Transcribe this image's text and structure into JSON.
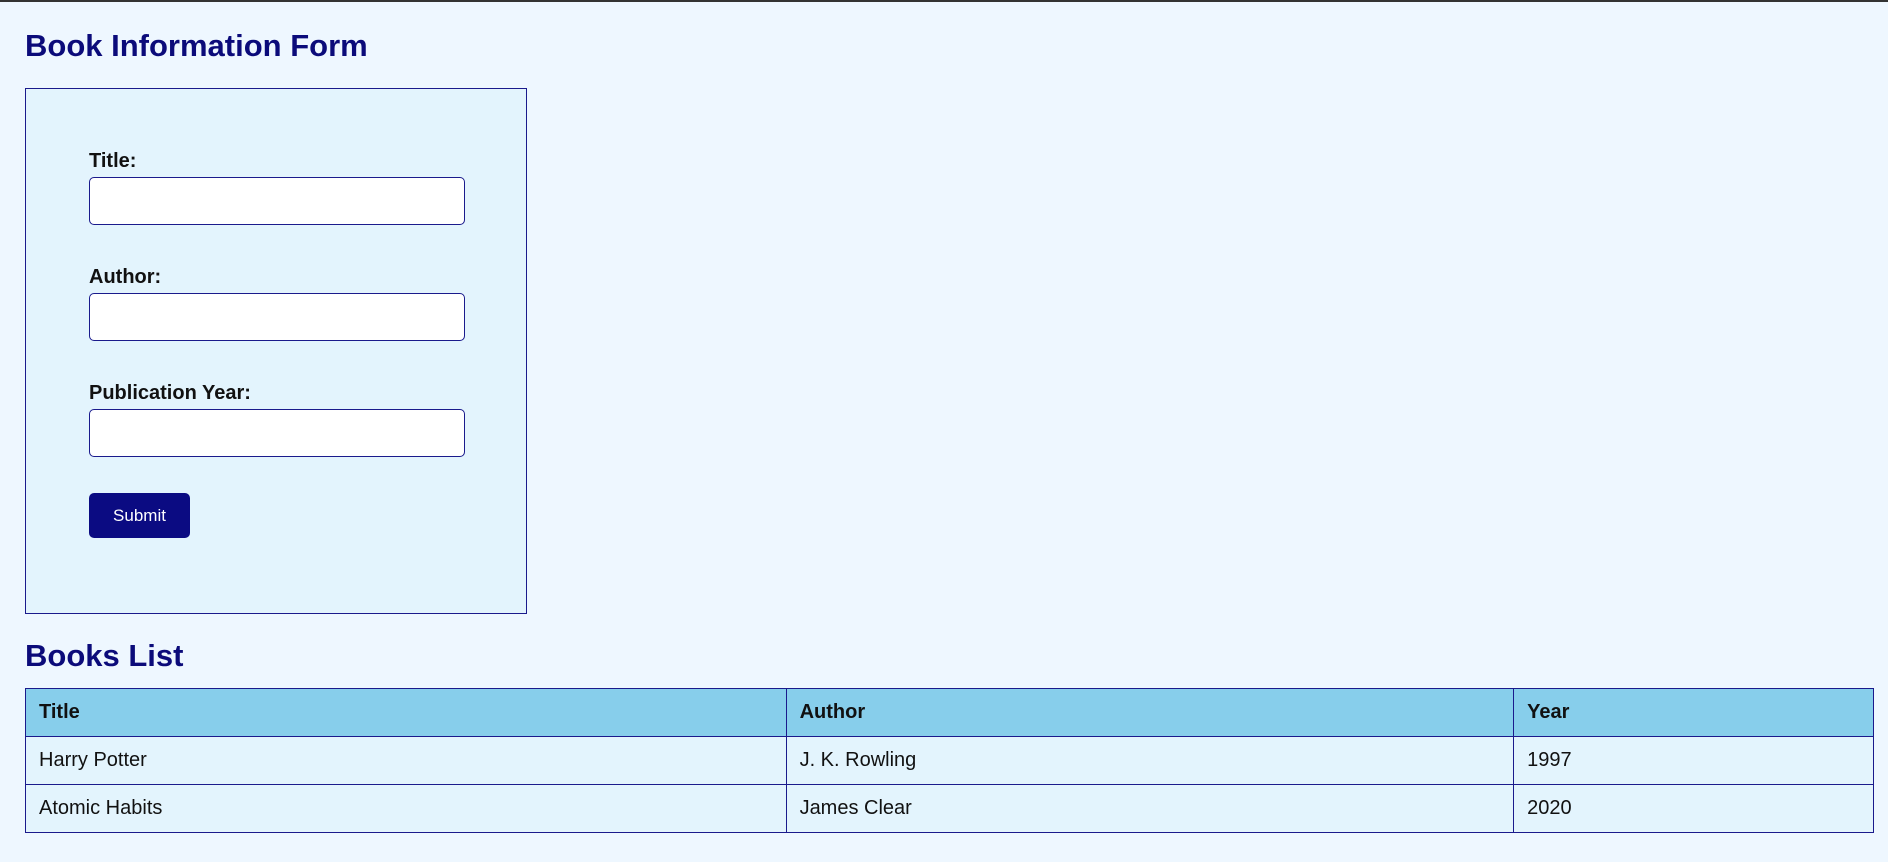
{
  "page": {
    "form_heading": "Book Information Form",
    "list_heading": "Books List"
  },
  "form": {
    "fields": [
      {
        "label": "Title:",
        "value": "",
        "placeholder": ""
      },
      {
        "label": "Author:",
        "value": "",
        "placeholder": ""
      },
      {
        "label": "Publication Year:",
        "value": "",
        "placeholder": ""
      }
    ],
    "submit_label": "Submit"
  },
  "table": {
    "headers": [
      "Title",
      "Author",
      "Year"
    ],
    "rows": [
      [
        "Harry Potter",
        "J. K. Rowling",
        "1997"
      ],
      [
        "Atomic Habits",
        "James Clear",
        "2020"
      ]
    ]
  },
  "colors": {
    "page_background": "#eef7ff",
    "heading": "#0b0b7a",
    "panel_background": "#e3f4fd",
    "border": "#1a1a8c",
    "button": "#0b0b82",
    "table_header": "#87ceeb"
  }
}
